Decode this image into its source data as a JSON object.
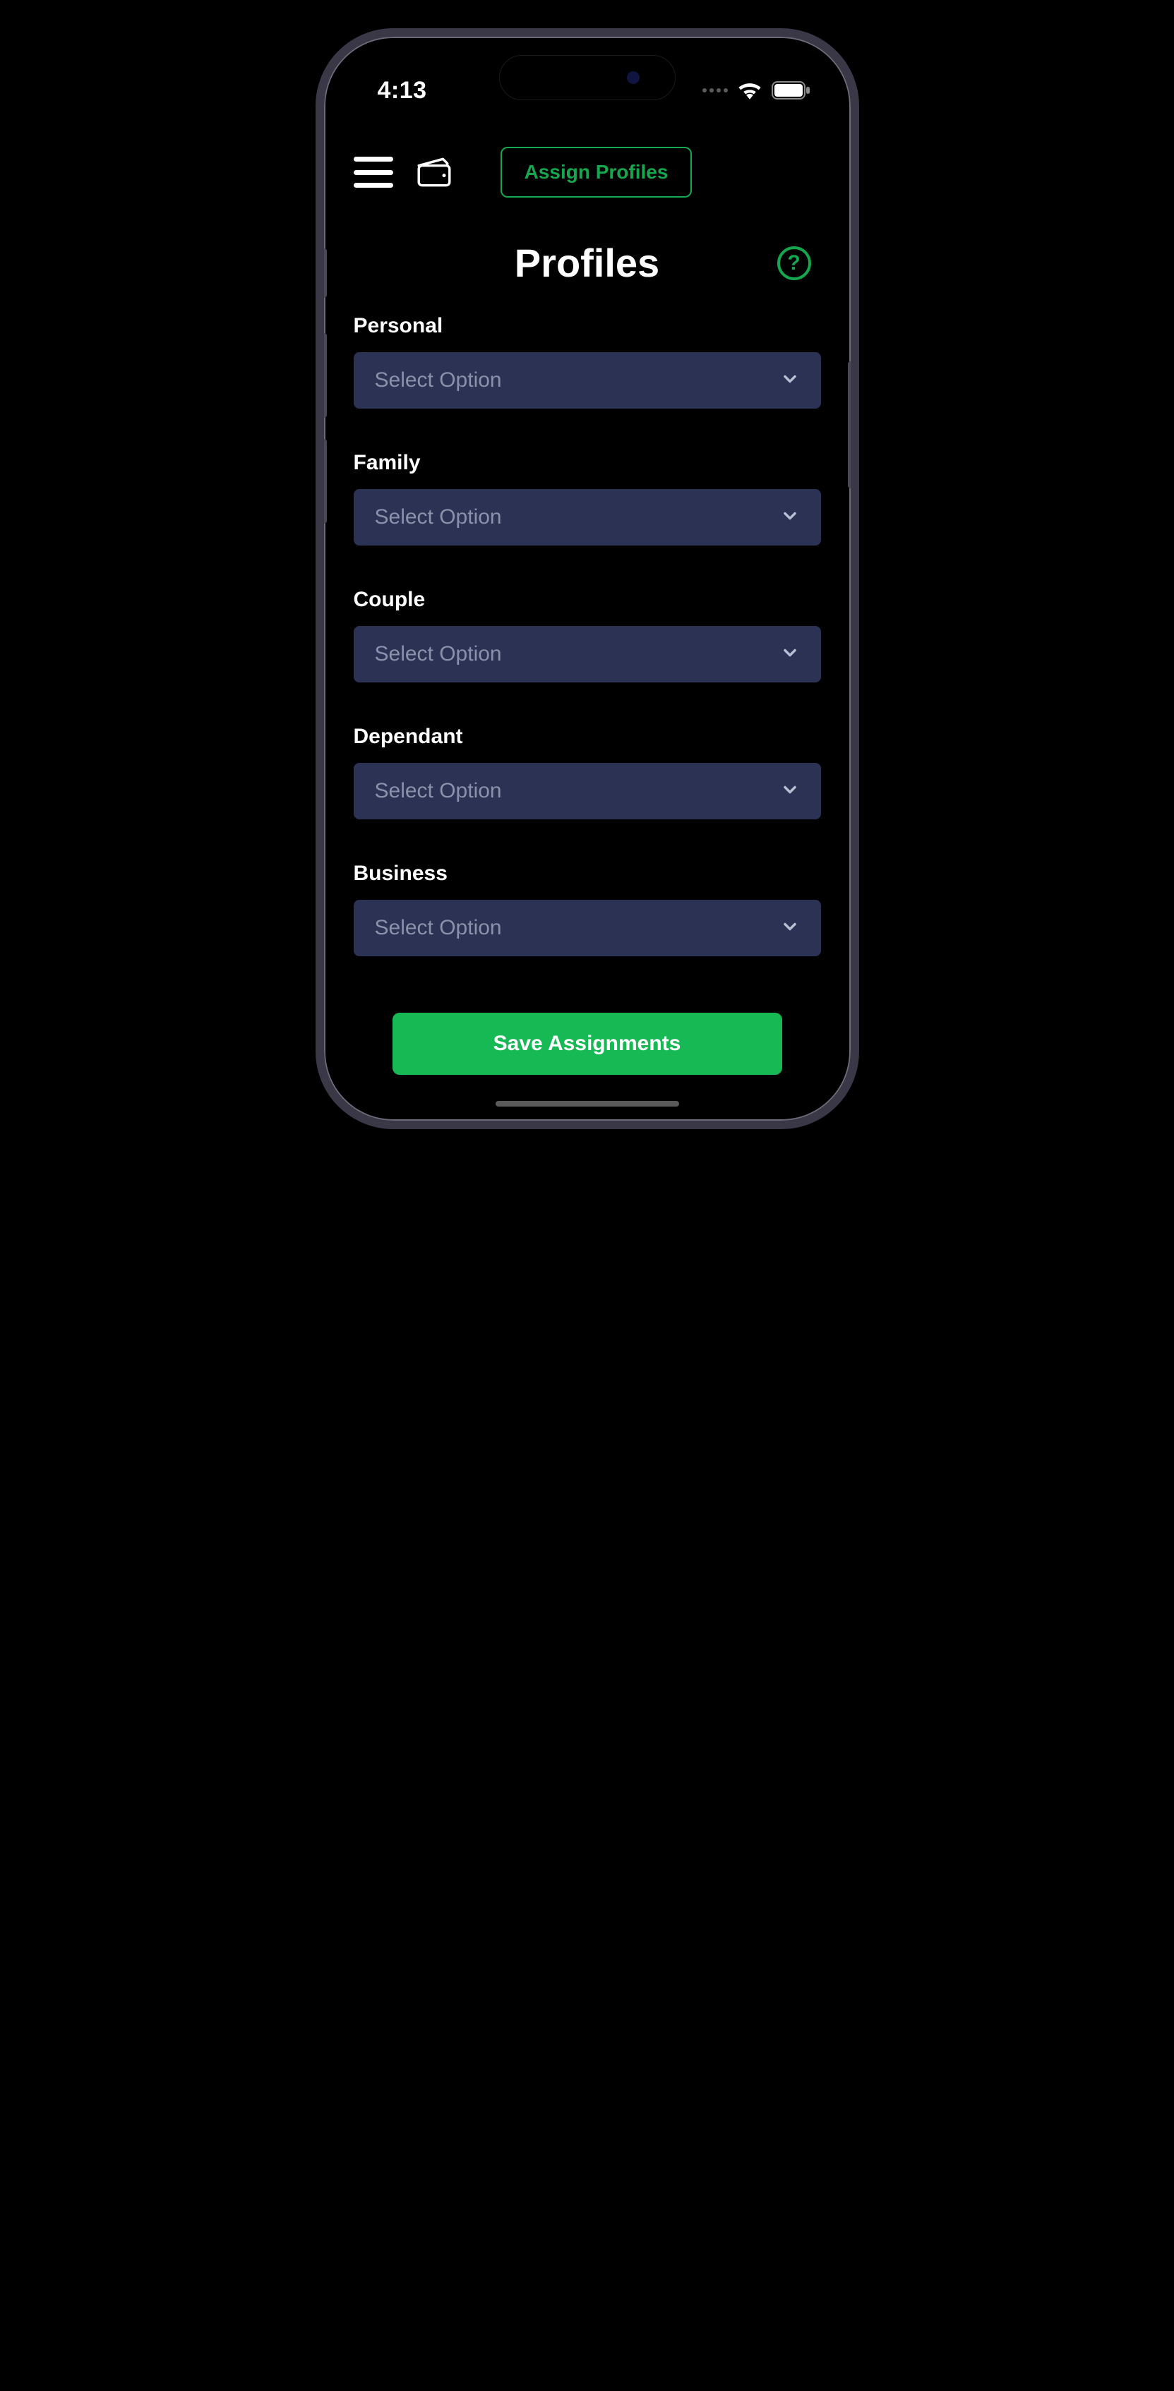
{
  "status": {
    "time": "4:13"
  },
  "topbar": {
    "assign_label": "Assign Profiles"
  },
  "title": "Profiles",
  "help_label": "?",
  "fields": [
    {
      "label": "Personal",
      "placeholder": "Select Option"
    },
    {
      "label": "Family",
      "placeholder": "Select Option"
    },
    {
      "label": "Couple",
      "placeholder": "Select Option"
    },
    {
      "label": "Dependant",
      "placeholder": "Select Option"
    },
    {
      "label": "Business",
      "placeholder": "Select Option"
    }
  ],
  "save_label": "Save Assignments"
}
